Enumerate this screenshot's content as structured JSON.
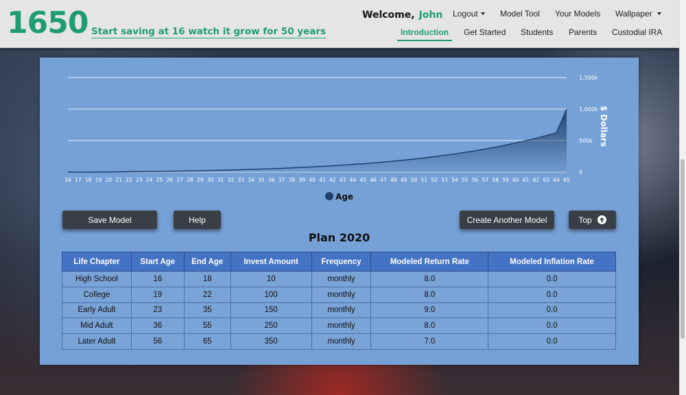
{
  "brand": {
    "logo": "1650",
    "tagline": "Start saving at 16 watch it grow for 50 years"
  },
  "welcome": {
    "label": "Welcome,",
    "user": "John"
  },
  "nav": {
    "logout": "Logout",
    "model_tool": "Model Tool",
    "your_models": "Your Models",
    "wallpaper": "Wallpaper",
    "introduction": "Introduction",
    "get_started": "Get Started",
    "students": "Students",
    "parents": "Parents",
    "custodial_ira": "Custodial IRA"
  },
  "buttons": {
    "save_model": "Save Model",
    "help": "Help",
    "create_another": "Create Another Model",
    "top": "Top"
  },
  "colors": {
    "brand_green": "#1f9c74",
    "panel": "#76a1d6",
    "table_header": "#4472c4",
    "series": "#1e3f6b"
  },
  "chart_data": {
    "type": "area",
    "xlabel": "",
    "ylabel": "$ Dollars",
    "legend": [
      "Age"
    ],
    "legend_placement": "bottom",
    "x": [
      16,
      17,
      18,
      19,
      20,
      21,
      22,
      23,
      24,
      25,
      26,
      27,
      28,
      29,
      30,
      31,
      32,
      33,
      34,
      35,
      36,
      37,
      38,
      39,
      40,
      41,
      42,
      43,
      44,
      45,
      46,
      47,
      48,
      49,
      50,
      51,
      52,
      53,
      54,
      55,
      56,
      57,
      58,
      59,
      60,
      61,
      62,
      63,
      64,
      65
    ],
    "y_ticks": [
      "0",
      "500k",
      "1,000k",
      "1,500k"
    ],
    "ylim": [
      0,
      1500000
    ],
    "grid": true,
    "series": [
      {
        "name": "Age",
        "values": [
          120,
          250,
          400,
          1600,
          2900,
          4400,
          6000,
          7900,
          9900,
          12000,
          14500,
          17000,
          20000,
          23000,
          26500,
          30000,
          34000,
          38500,
          43000,
          48500,
          54000,
          60000,
          67000,
          74500,
          82500,
          91000,
          100500,
          110500,
          121500,
          133500,
          146000,
          159500,
          174000,
          190000,
          207000,
          225000,
          245000,
          266000,
          288000,
          312000,
          338000,
          366000,
          396000,
          428000,
          462000,
          498000,
          537000,
          579000,
          624000,
          1000000
        ]
      }
    ]
  },
  "plan": {
    "title": "Plan 2020",
    "columns": [
      "Life Chapter",
      "Start Age",
      "End Age",
      "Invest Amount",
      "Frequency",
      "Modeled Return Rate",
      "Modeled Inflation Rate"
    ],
    "rows": [
      [
        "High School",
        "16",
        "18",
        "10",
        "monthly",
        "8.0",
        "0.0"
      ],
      [
        "College",
        "19",
        "22",
        "100",
        "monthly",
        "8.0",
        "0.0"
      ],
      [
        "Early Adult",
        "23",
        "35",
        "150",
        "monthly",
        "9.0",
        "0.0"
      ],
      [
        "Mid Adult",
        "36",
        "55",
        "250",
        "monthly",
        "8.0",
        "0.0"
      ],
      [
        "Later Adult",
        "56",
        "65",
        "350",
        "monthly",
        "7.0",
        "0.0"
      ]
    ]
  }
}
